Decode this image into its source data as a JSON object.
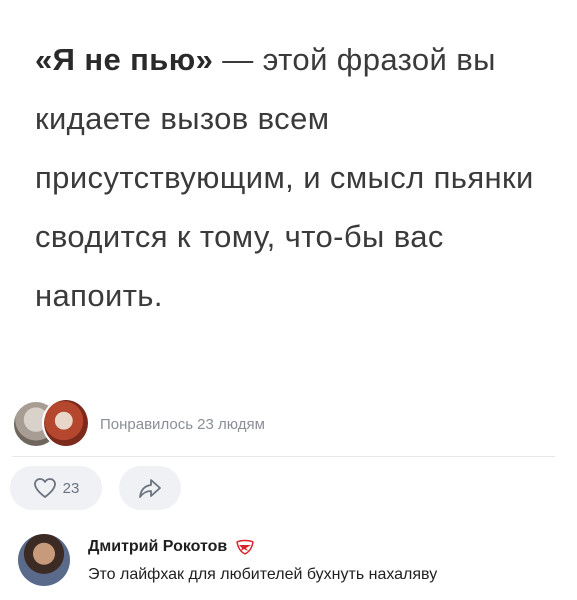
{
  "post": {
    "emphasis": "«Я не пью»",
    "text": " — этой фразой вы кидаете вызов всем присутствующим, и смысл пьянки сводится к тому, что-бы вас напоить."
  },
  "likes": {
    "label": "Понравилось 23 людям"
  },
  "actions": {
    "like_count": "23",
    "like_icon": "heart-icon",
    "share_icon": "share-arrow-icon"
  },
  "comment": {
    "author": "Дмитрий Рокотов",
    "badge_icon": "spartak-emblem-icon",
    "text": "Это лайфхак для любителей бухнуть нахаляву"
  },
  "colors": {
    "meta_text": "#8a8f96",
    "pill_bg": "#f0f1f4",
    "badge_red": "#d8242c"
  }
}
